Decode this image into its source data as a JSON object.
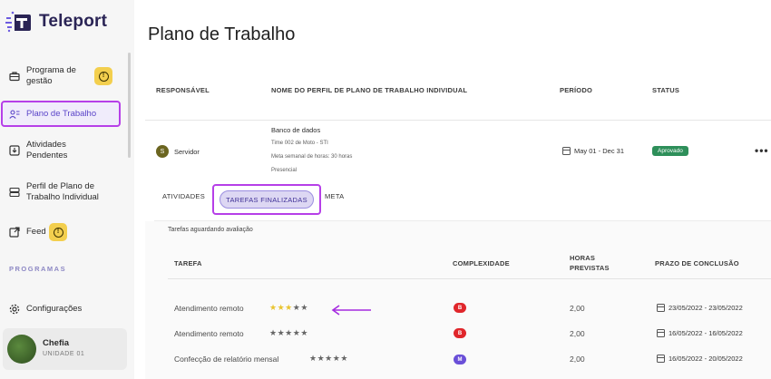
{
  "app": {
    "name": "Teleport",
    "brand_color": "#2a2455",
    "accent_color": "#b63fe8"
  },
  "sidebar": {
    "items": [
      {
        "label": "Programa de gestão",
        "icon": "briefcase-icon"
      },
      {
        "label": "Plano de Trabalho",
        "icon": "user-list-icon"
      },
      {
        "label": "Atividades Pendentes",
        "icon": "download-box-icon"
      },
      {
        "label": "Perfil de Plano de Trabalho Individual",
        "icon": "server-icon"
      },
      {
        "label": "Feed",
        "icon": "external-link-icon"
      },
      {
        "label": "Configurações",
        "icon": "gear-icon"
      }
    ],
    "section_title": "PROGRAMAS",
    "user": {
      "name": "Chefia",
      "unit": "UNIDADE 01"
    }
  },
  "page": {
    "title": "Plano de Trabalho"
  },
  "table_header": {
    "responsavel": "RESPONSÁVEL",
    "nome_perfil": "NOME DO PERFIL DE PLANO DE TRABALHO INDIVIDUAL",
    "periodo": "PERÍODO",
    "status": "STATUS"
  },
  "record": {
    "avatar_letter": "S",
    "responsavel": "Servidor",
    "perfil_title": "Banco de dados",
    "perfil_lines": [
      "Time 002 de Moto - STI",
      "Meta semanal de horas: 30 horas",
      "Presencial"
    ],
    "periodo": "May 01 - Dec 31",
    "status": "Aprovado",
    "more": "•••"
  },
  "tabs": {
    "atividades": "ATIVIDADES",
    "finalizadas": "TAREFAS FINALIZADAS",
    "meta": "META"
  },
  "tasks": {
    "note": "Tarefas aguardando avaliação",
    "columns": {
      "tarefa": "TAREFA",
      "complexidade": "COMPLEXIDADE",
      "horas": "HORAS PREVISTAS",
      "prazo": "PRAZO DE CONCLUSÃO"
    },
    "rows": [
      {
        "tarefa": "Atendimento remoto",
        "rating": 3,
        "complexidade": "B",
        "complexidade_color": "#e0262b",
        "horas": "2,00",
        "prazo": "23/05/2022 - 23/05/2022"
      },
      {
        "tarefa": "Atendimento remoto",
        "rating": 0,
        "complexidade": "B",
        "complexidade_color": "#e0262b",
        "horas": "2,00",
        "prazo": "16/05/2022 - 16/05/2022"
      },
      {
        "tarefa": "Confecção de relatório mensal",
        "rating": 0,
        "complexidade": "M",
        "complexidade_color": "#6a4fd8",
        "horas": "2,00",
        "prazo": "16/05/2022 - 20/05/2022"
      }
    ]
  }
}
